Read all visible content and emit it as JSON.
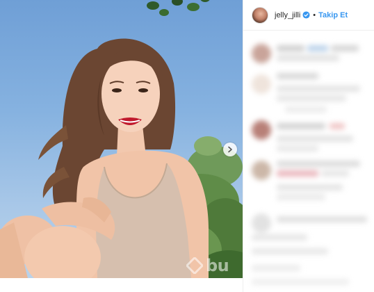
{
  "post": {
    "username": "jelly_jilli",
    "separator": "•",
    "follow_label": "Takip Et",
    "verified_icon": "verified-badge-icon",
    "next_icon": "chevron-right-icon"
  },
  "watermark": {
    "text": "bu"
  },
  "colors": {
    "follow_blue": "#3897f0",
    "verified_blue": "#3897f0",
    "sky": "#86b2e0",
    "lips": "#c0182c"
  }
}
